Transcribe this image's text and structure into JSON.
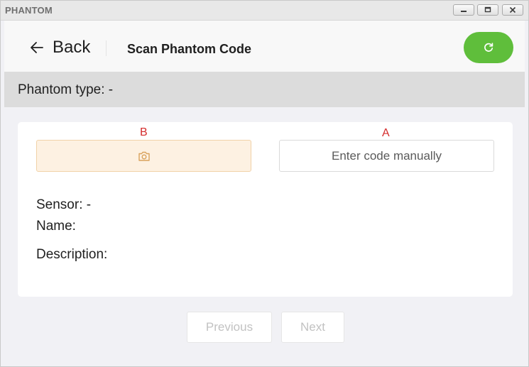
{
  "window": {
    "title": "PHANTOM",
    "controls": [
      "minimize-icon",
      "maximize-icon",
      "close-icon"
    ]
  },
  "header": {
    "back_label": "Back",
    "back_icon": "arrow-left-icon",
    "title": "Scan Phantom Code",
    "refresh_icon": "refresh-icon",
    "refresh_color": "#5fbe3b"
  },
  "phantom_type": {
    "text": "Phantom type: -"
  },
  "card": {
    "markers": {
      "b": "B",
      "a": "A"
    },
    "scan_button": {
      "icon": "camera-icon",
      "icon_color": "#d9a25c",
      "background": "#fdf1e2"
    },
    "manual_button_label": "Enter code manually",
    "sensor_text": "Sensor: -",
    "name_text": "Name:",
    "description_text": "Description:"
  },
  "footer": {
    "previous_label": "Previous",
    "next_label": "Next"
  }
}
